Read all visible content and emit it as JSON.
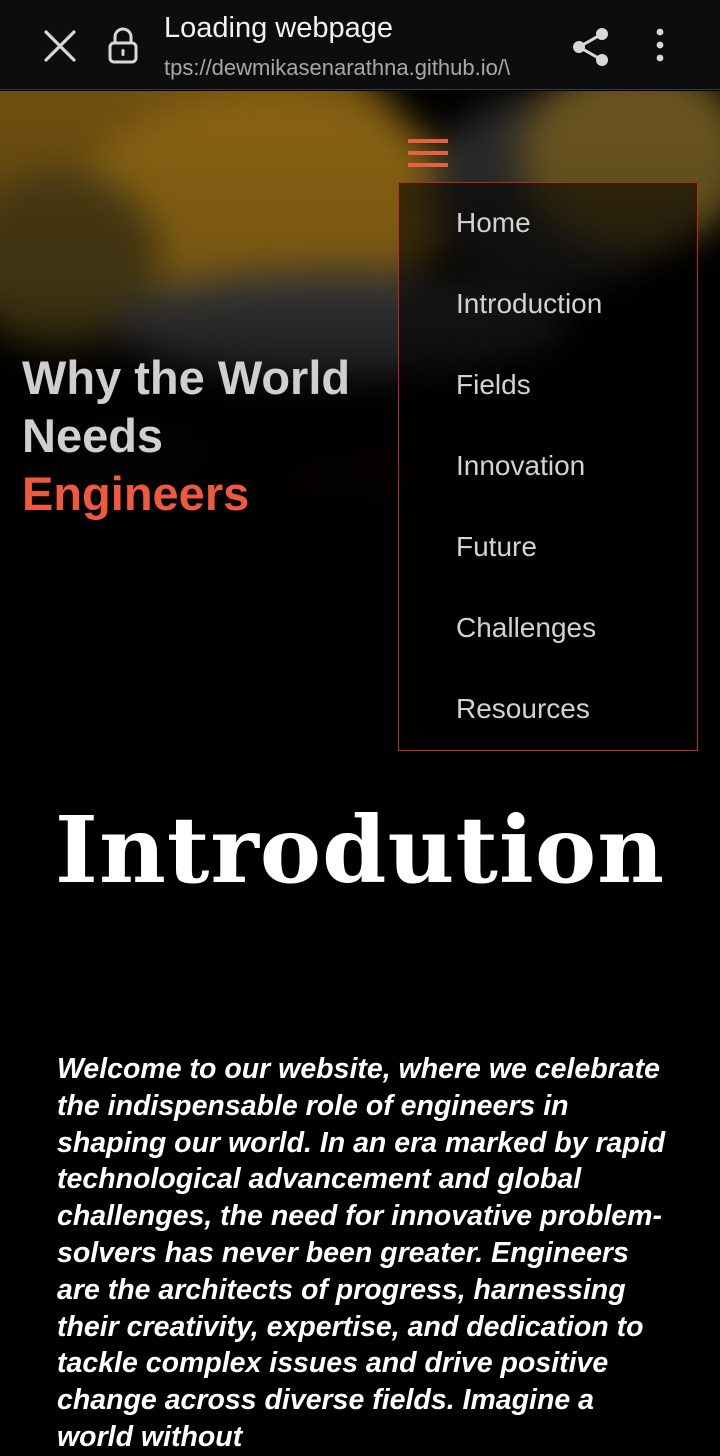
{
  "browser": {
    "title": "Loading webpage",
    "url": "tps://dewmikasenarathna.github.io/\\",
    "icons": [
      "close-icon",
      "lock-icon",
      "share-icon",
      "more-vert-icon"
    ]
  },
  "hero": {
    "heading_line1": "Why the World",
    "heading_line2": "Needs",
    "heading_accent": "Engineers",
    "accent_color": "#f0593e"
  },
  "menu": {
    "items": [
      "Home",
      "Introduction",
      "Fields",
      "Innovation",
      "Future",
      "Challenges",
      "Resources"
    ],
    "border_color": "#c0281a"
  },
  "intro": {
    "title": "Introdution",
    "body": "Welcome to our website, where we celebrate the indispensable role of engineers in shaping our world. In an era marked by rapid technological advancement and global challenges, the need for innovative problem-solvers has never been greater. Engineers are the architects of progress, harnessing their creativity, expertise, and dedication to tackle complex issues and drive positive change across diverse fields. Imagine a world without"
  }
}
